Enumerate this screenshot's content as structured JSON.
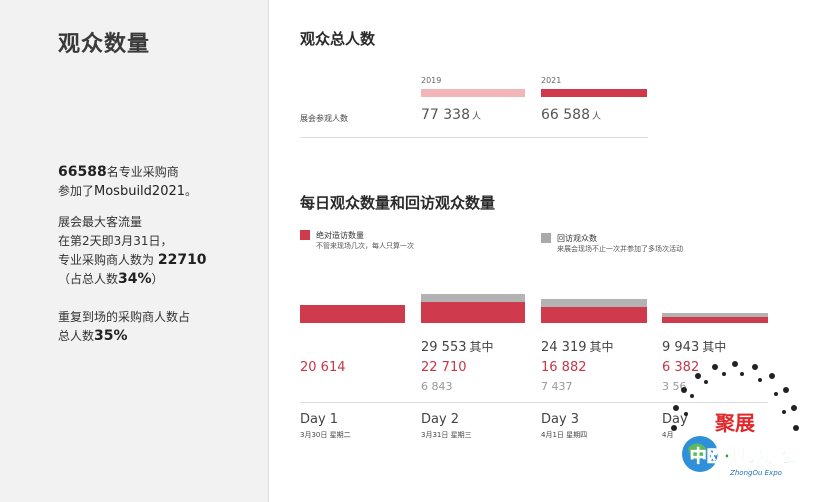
{
  "left": {
    "title": "观众数量",
    "p1_line1_num": "66588",
    "p1_line1_text": "名专业采购商",
    "p1_line2_prefix": "参加了",
    "p1_line2_event": "Mosbuild2021",
    "p1_line2_suffix": "。",
    "p2_line1": "展会最大客流量",
    "p2_line2": "在第2天即3月31日，",
    "p2_line3_text": "专业采购商人数为",
    "p2_line3_num": "22710",
    "p2_line4_pre": "（占总人数",
    "p2_line4_num": "34%",
    "p2_line4_post": "）",
    "p3_line1": "重复到场的采购商人数占",
    "p3_line2_pre": "总人数",
    "p3_line2_num": "35%"
  },
  "total_section": {
    "title": "观众总人数",
    "row_label": "展会参观人数",
    "years": [
      {
        "year": "2019",
        "value": "77 338",
        "unit": "人",
        "color": "#f2b5b8"
      },
      {
        "year": "2021",
        "value": "66 588",
        "unit": "人",
        "color": "#d03a4d"
      }
    ]
  },
  "daily_section": {
    "title": "每日观众数量和回访观众数量",
    "legend": [
      {
        "label": "绝对造访数量",
        "sub": "不管来现场几次，每人只算一次",
        "color": "#d03a4d"
      },
      {
        "label": "回访观众数",
        "sub": "来展会现场不止一次并参加了多场次活动",
        "color": "#aaaaaa"
      }
    ],
    "days": [
      {
        "label": "Day 1",
        "date": "3月30日 星期二",
        "total": "",
        "first": "20 614",
        "repeat": ""
      },
      {
        "label": "Day 2",
        "date": "3月31日 星期三",
        "total": "29 553",
        "total_suffix": "其中",
        "first": "22 710",
        "repeat": "6 843"
      },
      {
        "label": "Day 3",
        "date": "4月1日 星期四",
        "total": "24 319",
        "total_suffix": "其中",
        "first": "16 882",
        "repeat": "7 437"
      },
      {
        "label": "Day",
        "date": "4月",
        "total": "9 943",
        "total_suffix": "其中",
        "first": "6 382",
        "repeat": "3 56"
      }
    ],
    "colors": {
      "first": "#d03a4d",
      "repeat": "#b3b3b3"
    }
  },
  "logo": {
    "name_cn": "聚展",
    "brand_cn": "中欧·世界展会",
    "brand_en": "ZhongOu Expo"
  }
}
